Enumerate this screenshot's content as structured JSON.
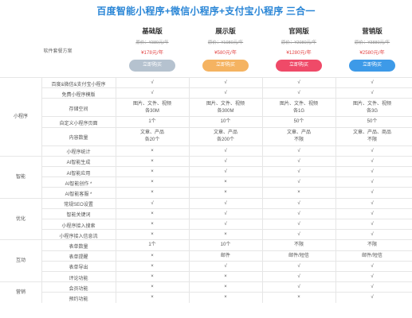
{
  "title": "百度智能小程序+微信小程序+支付宝小程序 三合一",
  "pricing": {
    "label": "软件套餐方案",
    "plans": [
      {
        "name": "基础版",
        "original": "原价：¥380元/年",
        "price": "¥178元/年",
        "button": "立即购买",
        "color": "#b5c2cf"
      },
      {
        "name": "展示版",
        "original": "原价：¥1080元/年",
        "price": "¥580元/年",
        "button": "立即购买",
        "color": "#f5b361"
      },
      {
        "name": "官网版",
        "original": "原价：¥2080元/年",
        "price": "¥1280元/年",
        "button": "立即购买",
        "color": "#ef4a68"
      },
      {
        "name": "营销版",
        "original": "原价：¥3880元/年",
        "price": "¥2580元/年",
        "button": "立即购买",
        "color": "#3d9ae8"
      }
    ]
  },
  "symbols": {
    "yes": "√",
    "no": "×"
  },
  "categories": [
    {
      "label": "小程序"
    },
    {
      "label": "智能"
    },
    {
      "label": "优化"
    },
    {
      "label": "互动"
    },
    {
      "label": "营销"
    }
  ],
  "features": [
    {
      "name": "百度&微信&支付宝小程序",
      "values": [
        "√",
        "√",
        "√",
        "√"
      ]
    },
    {
      "name": "免费小程序模版",
      "values": [
        "√",
        "√",
        "√",
        "√"
      ]
    },
    {
      "name": "存储空间",
      "values": [
        [
          "图片、文件、视频",
          "各30M"
        ],
        [
          "图片、文件、视频",
          "各300M"
        ],
        [
          "图片、文件、视频",
          "各1G"
        ],
        [
          "图片、文件、视频",
          "各3G"
        ]
      ]
    },
    {
      "name": "自定义小程序页面",
      "values": [
        "1个",
        "10个",
        "50个",
        "50个"
      ]
    },
    {
      "name": "内容数量",
      "values": [
        [
          "文章、产品",
          "各20个"
        ],
        [
          "文章、产品",
          "各200个"
        ],
        [
          "文章、产品",
          "不限"
        ],
        [
          "文章、产品、商品",
          "不限"
        ]
      ]
    },
    {
      "name": "小程序统计",
      "values": [
        "×",
        "√",
        "√",
        "√"
      ]
    },
    {
      "name": "AI智能生成",
      "values": [
        "×",
        "√",
        "√",
        "√"
      ]
    },
    {
      "name": "AI智能应用",
      "values": [
        "×",
        "√",
        "√",
        "√"
      ]
    },
    {
      "name": "AI智能创作 *",
      "values": [
        "×",
        "×",
        "√",
        "√"
      ]
    },
    {
      "name": "AI智能客服 *",
      "values": [
        "×",
        "×",
        "×",
        "√"
      ]
    },
    {
      "name": "常规SEO设置",
      "values": [
        "√",
        "√",
        "√",
        "√"
      ]
    },
    {
      "name": "智能关键词",
      "values": [
        "×",
        "√",
        "√",
        "√"
      ]
    },
    {
      "name": "小程序接入搜索",
      "values": [
        "×",
        "√",
        "√",
        "√"
      ]
    },
    {
      "name": "小程序接入信息流",
      "values": [
        "×",
        "×",
        "√",
        "√"
      ]
    },
    {
      "name": "表单数量",
      "values": [
        "1个",
        "10个",
        "不限",
        "不限"
      ]
    },
    {
      "name": "表单提醒",
      "values": [
        "×",
        "邮件",
        "邮件/短信",
        "邮件/短信"
      ]
    },
    {
      "name": "表单导出",
      "values": [
        "×",
        "√",
        "√",
        "√"
      ]
    },
    {
      "name": "评论功能",
      "values": [
        "×",
        "×",
        "√",
        "√"
      ]
    },
    {
      "name": "会员功能",
      "values": [
        "×",
        "×",
        "√",
        "√"
      ]
    },
    {
      "name": "预约功能",
      "values": [
        "×",
        "×",
        "×",
        "√"
      ]
    }
  ]
}
